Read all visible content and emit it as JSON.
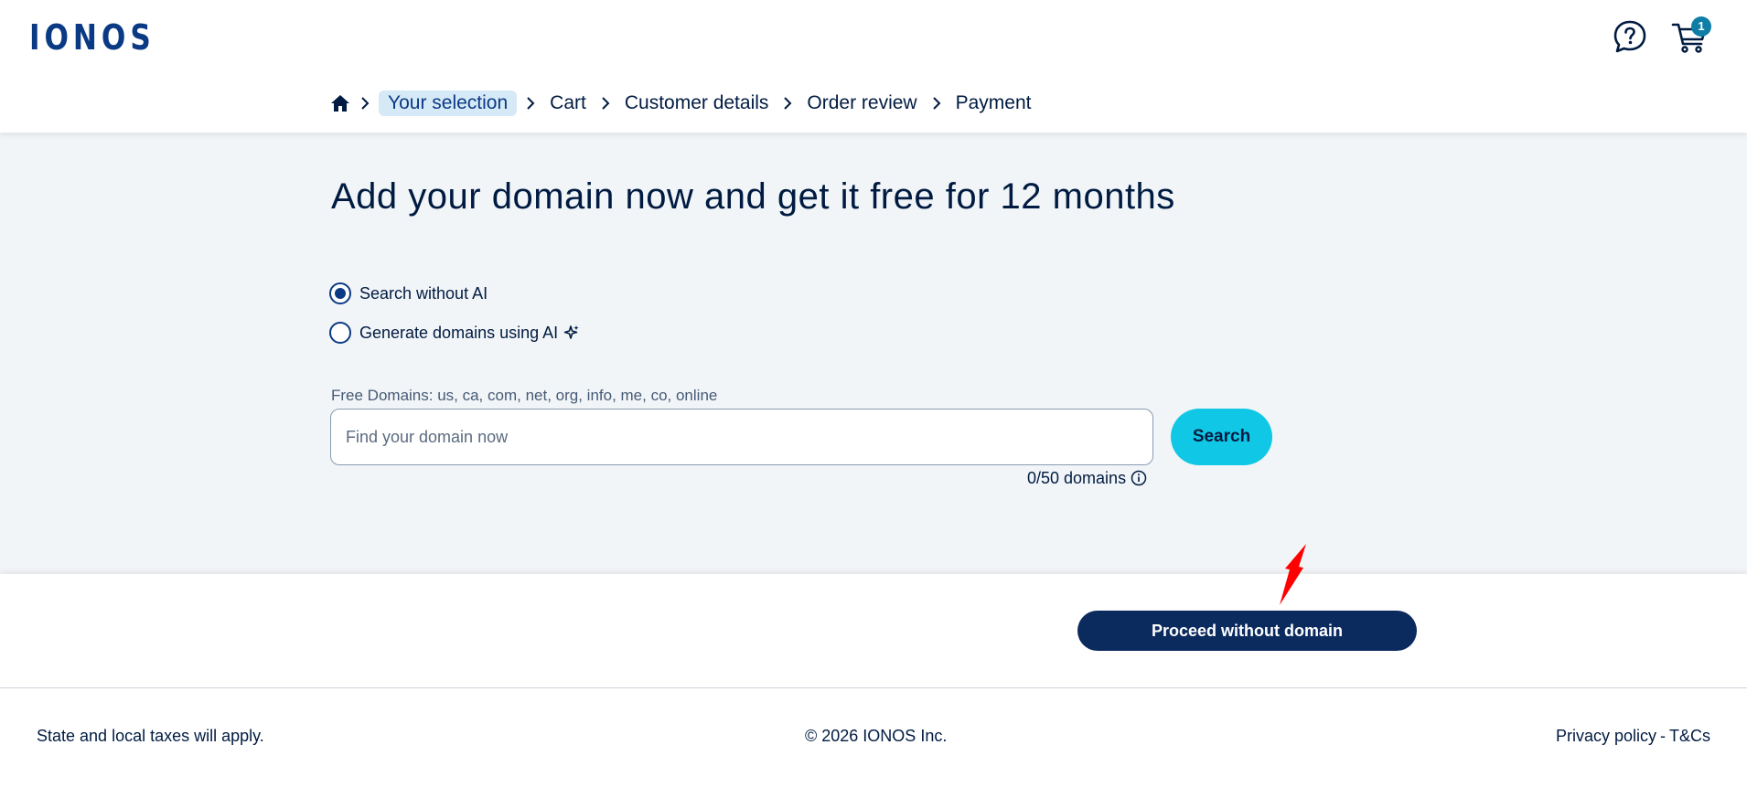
{
  "header": {
    "logo": "IONOS",
    "help_icon": "help-chat-icon",
    "cart_icon": "cart-icon",
    "cart_count": "1"
  },
  "breadcrumb": {
    "home_icon": "home-icon",
    "items": [
      {
        "label": "Your selection",
        "active": true
      },
      {
        "label": "Cart",
        "active": false
      },
      {
        "label": "Customer details",
        "active": false
      },
      {
        "label": "Order review",
        "active": false
      },
      {
        "label": "Payment",
        "active": false
      }
    ]
  },
  "main": {
    "title": "Add your domain now and get it free for 12 months",
    "search_mode": {
      "options": [
        {
          "label": "Search without AI",
          "selected": true
        },
        {
          "label": "Generate domains using AI",
          "selected": false
        }
      ]
    },
    "free_domains_label": "Free Domains: us, ca, com, net, org, info, me, co, online",
    "search": {
      "placeholder": "Find your domain now",
      "value": "",
      "button_label": "Search",
      "counter": "0/50 domains"
    }
  },
  "actions": {
    "proceed_label": "Proceed without domain"
  },
  "footer": {
    "taxes_note": "State and local taxes will apply.",
    "copyright": "© 2026 IONOS Inc.",
    "privacy": "Privacy policy",
    "separator": "-",
    "terms": "T&Cs"
  },
  "colors": {
    "brand_navy": "#0b2a5e",
    "logo_blue": "#0b3a84",
    "search_cyan": "#11c7e6",
    "active_crumb_bg": "#d6e9f7",
    "badge_teal": "#0f7ea6",
    "annotation_arrow": "#ff0000"
  }
}
